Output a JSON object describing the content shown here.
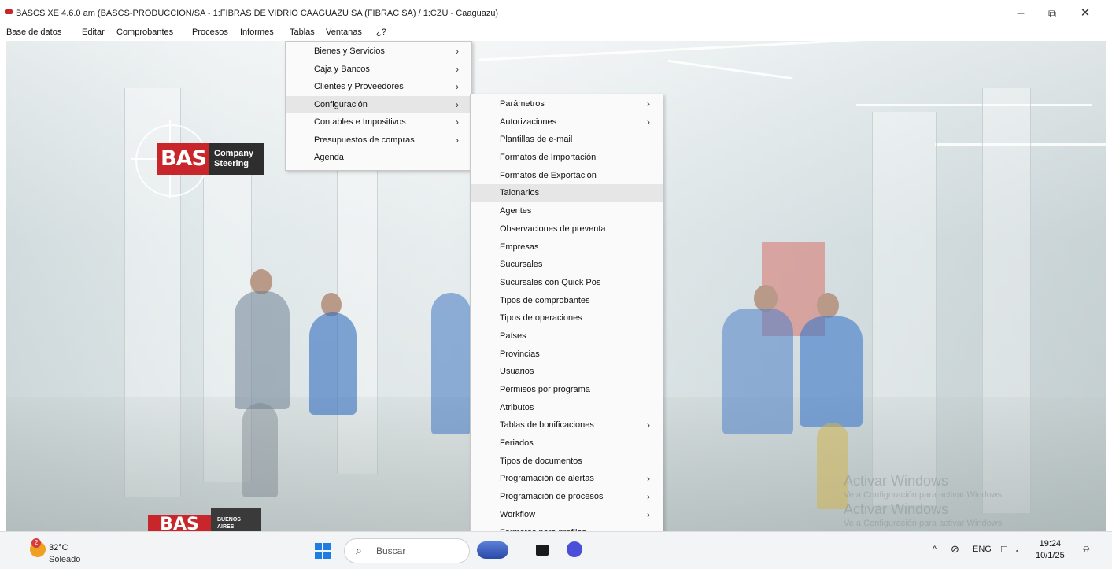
{
  "window": {
    "title": "BASCS XE 4.6.0 am (BASCS-PRODUCCION/SA - 1:FIBRAS DE VIDRIO CAAGUAZU SA (FIBRAC SA) / 1:CZU - Caaguazu)",
    "minimize_glyph": "–",
    "maximize_glyph": "⧉",
    "close_glyph": "✕"
  },
  "menubar": {
    "items": [
      "Base de datos",
      "Editar",
      "Comprobantes",
      "Procesos",
      "Informes",
      "Tablas",
      "Ventanas",
      "¿?"
    ]
  },
  "logo": {
    "brand": "BAS",
    "line1": "Company",
    "line2": "Steering",
    "bottom_brand": "BAS",
    "bottom_line1": "BUENOS",
    "bottom_line2": "AIRES"
  },
  "tablas_menu": {
    "items": [
      {
        "label": "Bienes y Servicios",
        "submenu": true
      },
      {
        "label": "Caja y Bancos",
        "submenu": true
      },
      {
        "label": "Clientes y Proveedores",
        "submenu": true
      },
      {
        "label": "Configuración",
        "submenu": true,
        "highlighted": true
      },
      {
        "label": "Contables e Impositivos",
        "submenu": true
      },
      {
        "label": "Presupuestos de compras",
        "submenu": true
      },
      {
        "label": "Agenda",
        "submenu": false
      }
    ]
  },
  "configuracion_menu": {
    "items": [
      {
        "label": "Parámetros",
        "submenu": true
      },
      {
        "label": "Autorizaciones",
        "submenu": true
      },
      {
        "label": "Plantillas de e-mail",
        "submenu": false
      },
      {
        "label": "Formatos de Importación",
        "submenu": false
      },
      {
        "label": "Formatos de Exportación",
        "submenu": false
      },
      {
        "label": "Talonarios",
        "submenu": false,
        "highlighted": true
      },
      {
        "label": "Agentes",
        "submenu": false
      },
      {
        "label": "Observaciones de preventa",
        "submenu": false
      },
      {
        "label": "Empresas",
        "submenu": false
      },
      {
        "label": "Sucursales",
        "submenu": false
      },
      {
        "label": "Sucursales con Quick Pos",
        "submenu": false
      },
      {
        "label": "Tipos de comprobantes",
        "submenu": false
      },
      {
        "label": "Tipos de operaciones",
        "submenu": false
      },
      {
        "label": "Países",
        "submenu": false
      },
      {
        "label": "Provincias",
        "submenu": false
      },
      {
        "label": "Usuarios",
        "submenu": false
      },
      {
        "label": "Permisos por programa",
        "submenu": false
      },
      {
        "label": "Atributos",
        "submenu": false
      },
      {
        "label": "Tablas de bonificaciones",
        "submenu": true
      },
      {
        "label": "Feriados",
        "submenu": false
      },
      {
        "label": "Tipos de documentos",
        "submenu": false
      },
      {
        "label": "Programación de alertas",
        "submenu": true
      },
      {
        "label": "Programación de procesos",
        "submenu": true
      },
      {
        "label": "Workflow",
        "submenu": true
      },
      {
        "label": "Formatos para prefijos",
        "submenu": false
      }
    ]
  },
  "watermark": {
    "line1": "Activar Windows",
    "line2": "Ve a Configuración para activar Windows.",
    "line3": "Activar Windows",
    "line4": "Ve a Configuración para activar Windows"
  },
  "taskbar": {
    "weather_badge": "2",
    "temperature": "32°C",
    "condition": "Soleado",
    "search_placeholder": "Buscar",
    "language": "ENG",
    "time": "19:24",
    "date": "10/1/25"
  },
  "colors": {
    "brand_red": "#c8262b",
    "menu_highlight": "#e6e6e6",
    "windows_blue": "#1f7ce0"
  }
}
